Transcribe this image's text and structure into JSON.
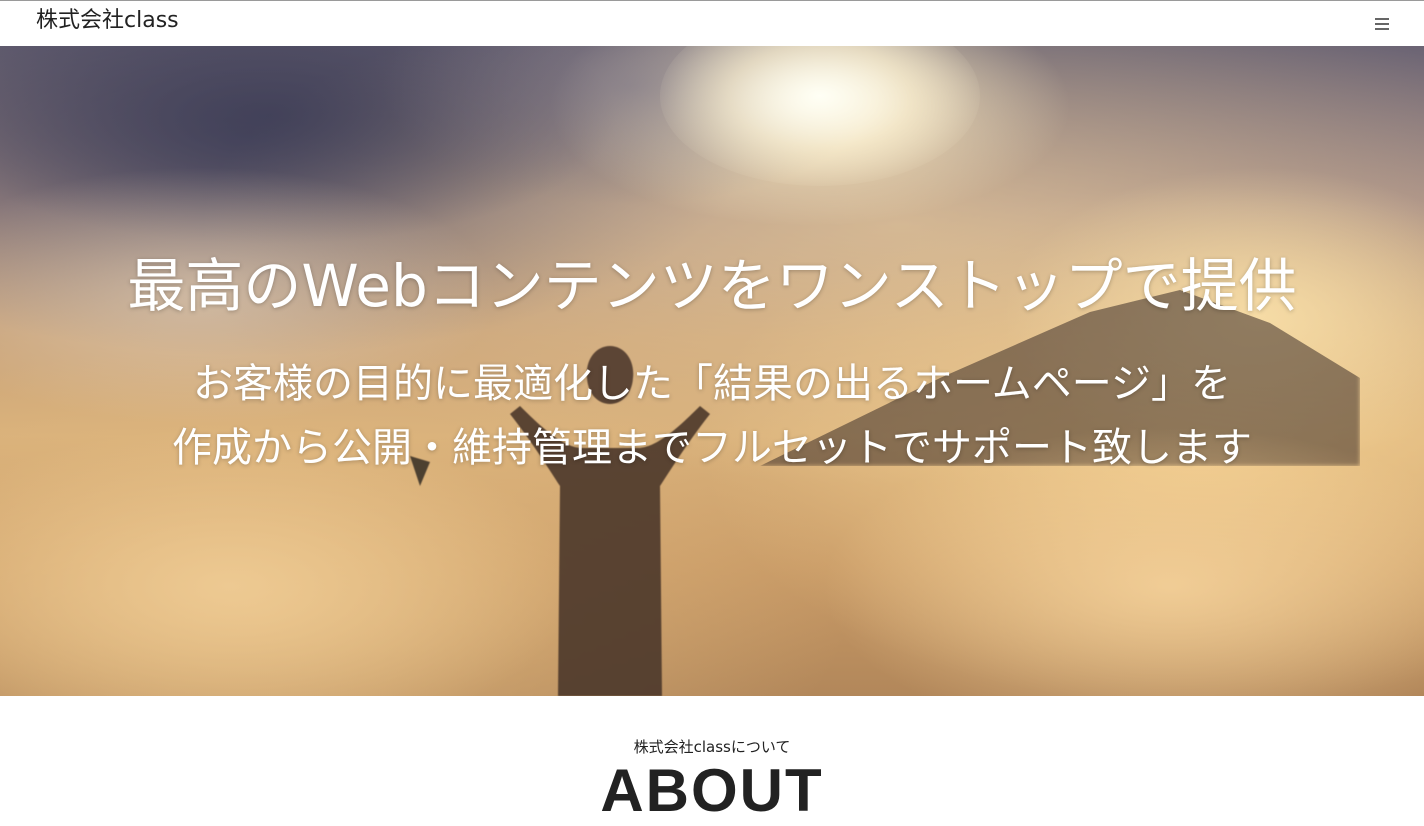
{
  "header": {
    "brand": "株式会社class",
    "menu_icon": "hamburger-menu-icon"
  },
  "hero": {
    "title": "最高のWebコンテンツをワンストップで提供",
    "subtitle_line1": "お客様の目的に最適化した「結果の出るホームページ」を",
    "subtitle_line2": "作成から公開・維持管理までフルセットでサポート致します"
  },
  "about": {
    "eyebrow": "株式会社classについて",
    "title": "ABOUT"
  }
}
